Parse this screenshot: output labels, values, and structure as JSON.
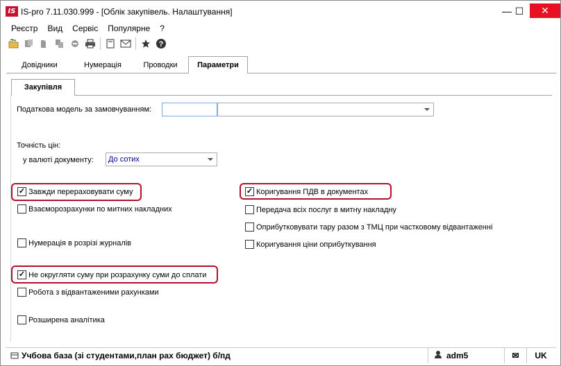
{
  "window": {
    "logo_text": "IS",
    "title": "IS-pro 7.11.030.999 - [Облік закупівель. Налаштування]",
    "minimize_glyph": "—",
    "maximize_glyph": "☐",
    "close_glyph": "✕"
  },
  "menu": {
    "items": [
      "Реєстр",
      "Вид",
      "Сервіс",
      "Популярне",
      "?"
    ]
  },
  "toolbar": {
    "icons": [
      "open-icon",
      "copy-icon",
      "paste-icon",
      "duplicate-icon",
      "delete-icon",
      "print-icon",
      "document-icon",
      "mail-icon",
      "star-icon",
      "help-icon"
    ]
  },
  "tabs": {
    "items": [
      "Довідники",
      "Нумерація",
      "Проводки",
      "Параметри"
    ],
    "active": "Параметри"
  },
  "subtab": {
    "label": "Закупівля"
  },
  "form": {
    "tax_model_label": "Податкова модель за замовчуванням:",
    "tax_model_code": "",
    "tax_model_name": "",
    "price_precision_label": "Точність цін:",
    "doc_currency_label": "у валюті документу:",
    "doc_currency_value": "До сотих"
  },
  "checkboxes_left": [
    {
      "label": "Завжди перераховувати суму",
      "checked": true,
      "highlighted": true
    },
    {
      "label": "Взаєморозрахунки по митних накладних",
      "checked": false,
      "highlighted": false
    },
    {
      "label": "Нумерація в розрізі журналів",
      "checked": false,
      "highlighted": false
    },
    {
      "label": "Не округляти суму при розрахунку суми до сплати",
      "checked": true,
      "highlighted": true
    },
    {
      "label": "Робота з відвантаженими рахунками",
      "checked": false,
      "highlighted": false
    },
    {
      "label": "Розширена аналітика",
      "checked": false,
      "highlighted": false
    }
  ],
  "checkboxes_right": [
    {
      "label": "Коригування ПДВ в документах",
      "checked": true,
      "highlighted": true
    },
    {
      "label": "Передача всіх послуг в митну накладну",
      "checked": false,
      "highlighted": false
    },
    {
      "label": "Оприбутковувати тару разом з ТМЦ при частковому відвантаженні",
      "checked": false,
      "highlighted": false
    },
    {
      "label": "Коригування ціни оприбуткування",
      "checked": false,
      "highlighted": false
    }
  ],
  "statusbar": {
    "database": "Учбова база (зі студентами,план рах бюджет) б/пд",
    "user": "adm5",
    "mail_glyph": "✉",
    "language": "UK"
  },
  "colors": {
    "highlight": "#b0102a",
    "close_button": "#e81123",
    "logo": "#c8102e",
    "combo_text": "#00008b"
  }
}
